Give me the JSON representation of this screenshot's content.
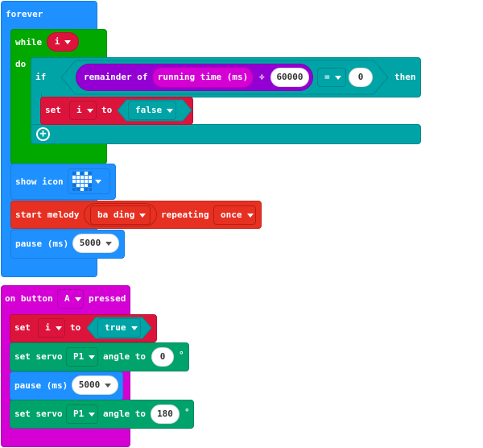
{
  "forever_block": {
    "label": "forever",
    "while": {
      "label": "while",
      "condition_var": "i",
      "do_label": "do",
      "if": {
        "if_label": "if",
        "then_label": "then",
        "remainder_label": "remainder of",
        "running_time_label": "running time (ms)",
        "divide_symbol": "÷",
        "divisor": "60000",
        "compare_op": "=",
        "compare_value": "0",
        "set": {
          "set_label": "set",
          "var": "i",
          "to_label": "to",
          "value": "false"
        },
        "add_icon": "plus-circle-icon"
      }
    },
    "show_icon": {
      "label": "show icon",
      "icon": "heart",
      "grid": [
        [
          0,
          1,
          0,
          1,
          0
        ],
        [
          1,
          1,
          1,
          1,
          1
        ],
        [
          1,
          1,
          1,
          1,
          1
        ],
        [
          0,
          1,
          1,
          1,
          0
        ],
        [
          0,
          0,
          1,
          0,
          0
        ]
      ]
    },
    "start_melody": {
      "label": "start melody",
      "melody": "ba ding",
      "repeating_label": "repeating",
      "repeat_mode": "once"
    },
    "pause": {
      "label": "pause (ms)",
      "value": "5000"
    }
  },
  "on_button_block": {
    "on_label": "on button",
    "button": "A",
    "pressed_label": "pressed",
    "set": {
      "set_label": "set",
      "var": "i",
      "to_label": "to",
      "value": "true"
    },
    "servo1": {
      "label": "set servo",
      "pin": "P1",
      "angle_label": "angle to",
      "angle": "0",
      "degree": "°"
    },
    "pause": {
      "label": "pause (ms)",
      "value": "5000"
    },
    "servo2": {
      "label": "set servo",
      "pin": "P1",
      "angle_label": "angle to",
      "angle": "180",
      "degree": "°"
    }
  },
  "colors": {
    "loops": "#1e90ff",
    "logic": "#00a4a6",
    "while": "#00a800",
    "variables": "#dc143c",
    "math": "#9400d3",
    "input": "#d400d4",
    "music": "#e63022",
    "pins": "#00a36b"
  }
}
